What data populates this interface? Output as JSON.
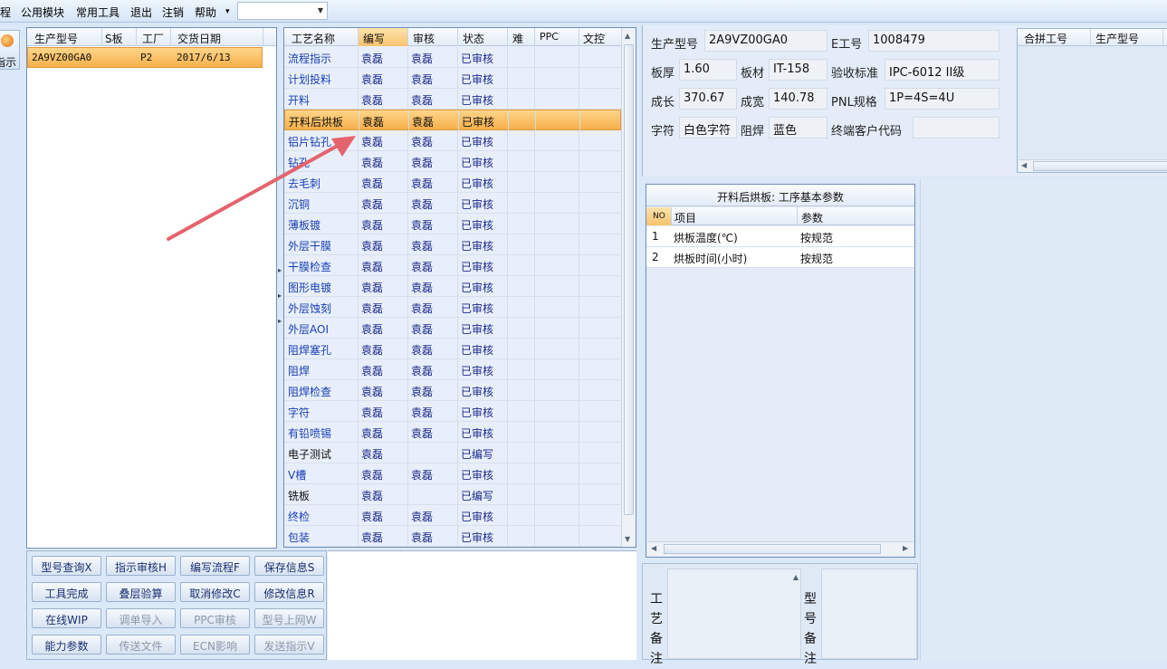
{
  "menubar": {
    "items": [
      "程",
      "公用模块",
      "常用工具",
      "退出",
      "注销",
      "帮助"
    ],
    "dropdown_arrow": "▾",
    "combo_value": ""
  },
  "leftbtn": {
    "label": "指示"
  },
  "orders": {
    "headers": [
      "生产型号",
      "S板",
      "工厂",
      "交货日期"
    ],
    "rows": [
      {
        "model": "2A9VZ00GA0",
        "s": "",
        "factory": "P2",
        "date": "2017/6/13"
      }
    ]
  },
  "process": {
    "headers": [
      "工艺名称",
      "编写",
      "审核",
      "状态",
      "难",
      "PPC",
      "文控"
    ],
    "rows": [
      {
        "name": "流程指示",
        "writer": "袁磊",
        "reviewer": "袁磊",
        "status": "已审核",
        "hl": false,
        "blue": true
      },
      {
        "name": "计划投料",
        "writer": "袁磊",
        "reviewer": "袁磊",
        "status": "已审核",
        "hl": false,
        "blue": true
      },
      {
        "name": "开料",
        "writer": "袁磊",
        "reviewer": "袁磊",
        "status": "已审核",
        "hl": false,
        "blue": true
      },
      {
        "name": "开料后烘板",
        "writer": "袁磊",
        "reviewer": "袁磊",
        "status": "已审核",
        "hl": true,
        "blue": false
      },
      {
        "name": "铝片钻孔",
        "writer": "袁磊",
        "reviewer": "袁磊",
        "status": "已审核",
        "hl": false,
        "blue": true
      },
      {
        "name": "钻孔",
        "writer": "袁磊",
        "reviewer": "袁磊",
        "status": "已审核",
        "hl": false,
        "blue": true
      },
      {
        "name": "去毛刺",
        "writer": "袁磊",
        "reviewer": "袁磊",
        "status": "已审核",
        "hl": false,
        "blue": true
      },
      {
        "name": "沉铜",
        "writer": "袁磊",
        "reviewer": "袁磊",
        "status": "已审核",
        "hl": false,
        "blue": true
      },
      {
        "name": "薄板镀",
        "writer": "袁磊",
        "reviewer": "袁磊",
        "status": "已审核",
        "hl": false,
        "blue": true
      },
      {
        "name": "外层干膜",
        "writer": "袁磊",
        "reviewer": "袁磊",
        "status": "已审核",
        "hl": false,
        "blue": true
      },
      {
        "name": "干膜检查",
        "writer": "袁磊",
        "reviewer": "袁磊",
        "status": "已审核",
        "hl": false,
        "blue": true
      },
      {
        "name": "图形电镀",
        "writer": "袁磊",
        "reviewer": "袁磊",
        "status": "已审核",
        "hl": false,
        "blue": true
      },
      {
        "name": "外层蚀刻",
        "writer": "袁磊",
        "reviewer": "袁磊",
        "status": "已审核",
        "hl": false,
        "blue": true
      },
      {
        "name": "外层AOI",
        "writer": "袁磊",
        "reviewer": "袁磊",
        "status": "已审核",
        "hl": false,
        "blue": true
      },
      {
        "name": "阻焊塞孔",
        "writer": "袁磊",
        "reviewer": "袁磊",
        "status": "已审核",
        "hl": false,
        "blue": true
      },
      {
        "name": "阻焊",
        "writer": "袁磊",
        "reviewer": "袁磊",
        "status": "已审核",
        "hl": false,
        "blue": true
      },
      {
        "name": "阻焊检查",
        "writer": "袁磊",
        "reviewer": "袁磊",
        "status": "已审核",
        "hl": false,
        "blue": true
      },
      {
        "name": "字符",
        "writer": "袁磊",
        "reviewer": "袁磊",
        "status": "已审核",
        "hl": false,
        "blue": true
      },
      {
        "name": "有铅喷锡",
        "writer": "袁磊",
        "reviewer": "袁磊",
        "status": "已审核",
        "hl": false,
        "blue": true
      },
      {
        "name": "电子测试",
        "writer": "袁磊",
        "reviewer": "",
        "status": "已编写",
        "hl": false,
        "blue": false
      },
      {
        "name": "V槽",
        "writer": "袁磊",
        "reviewer": "袁磊",
        "status": "已审核",
        "hl": false,
        "blue": true
      },
      {
        "name": "铣板",
        "writer": "袁磊",
        "reviewer": "",
        "status": "已编写",
        "hl": false,
        "blue": false
      },
      {
        "name": "终检",
        "writer": "袁磊",
        "reviewer": "袁磊",
        "status": "已审核",
        "hl": false,
        "blue": true
      },
      {
        "name": "包装",
        "writer": "袁磊",
        "reviewer": "袁磊",
        "status": "已审核",
        "hl": false,
        "blue": true
      }
    ]
  },
  "info": {
    "model_label": "生产型号",
    "model": "2A9VZ00GA0",
    "e_label": "E工号",
    "e": "1008479",
    "thick_label": "板厚",
    "thick": "1.60",
    "mat_label": "板材",
    "mat": "IT-158",
    "std_label": "验收标准",
    "std": "IPC-6012 II级",
    "len_label": "成长",
    "len": "370.67",
    "wid_label": "成宽",
    "wid": "140.78",
    "pnl_label": "PNL规格",
    "pnl": "1P=4S=4U",
    "char_label": "字符",
    "char": "白色字符",
    "mask_label": "阻焊",
    "mask": "蓝色",
    "cust_label": "终端客户代码",
    "cust": ""
  },
  "combine": {
    "headers": [
      "合拼工号",
      "生产型号"
    ]
  },
  "params": {
    "title": "开料后烘板: 工序基本参数",
    "headers": [
      "NO",
      "项目",
      "参数"
    ],
    "rows": [
      {
        "no": "1",
        "item": "烘板温度(℃)",
        "value": "按规范"
      },
      {
        "no": "2",
        "item": "烘板时间(小时)",
        "value": "按规范"
      }
    ]
  },
  "buttons": [
    {
      "label": "型号查询X",
      "disabled": false
    },
    {
      "label": "指示审核H",
      "disabled": false
    },
    {
      "label": "编写流程F",
      "disabled": false
    },
    {
      "label": "保存信息S",
      "disabled": false
    },
    {
      "label": "工具完成",
      "disabled": false
    },
    {
      "label": "叠层验算",
      "disabled": false
    },
    {
      "label": "取消修改C",
      "disabled": false
    },
    {
      "label": "修改信息R",
      "disabled": false
    },
    {
      "label": "在线WIP",
      "disabled": false
    },
    {
      "label": "调单导入",
      "disabled": true
    },
    {
      "label": "PPC审核",
      "disabled": true
    },
    {
      "label": "型号上网W",
      "disabled": true
    },
    {
      "label": "能力参数",
      "disabled": false
    },
    {
      "label": "传送文件",
      "disabled": true
    },
    {
      "label": "ECN影响",
      "disabled": true
    },
    {
      "label": "发送指示V",
      "disabled": true
    }
  ],
  "notes": {
    "craft_label": "工艺备注",
    "model_label": "型号备注"
  }
}
